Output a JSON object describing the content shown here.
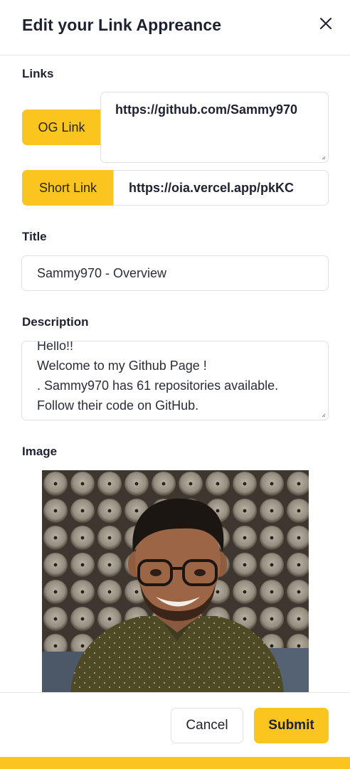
{
  "modal": {
    "title": "Edit your Link Appreance",
    "close_icon": "close-icon"
  },
  "links": {
    "label": "Links",
    "og": {
      "addon_label": "OG Link",
      "value": "https://github.com/Sammy970"
    },
    "short": {
      "addon_label": "Short Link",
      "value": "https://oia.vercel.app/pkKC"
    }
  },
  "title_section": {
    "label": "Title",
    "value": "Sammy970 - Overview"
  },
  "description_section": {
    "label": "Description",
    "value": "Hello!!\nWelcome to my Github Page !\n. Sammy970 has 61 repositories available.\nFollow their code on GitHub."
  },
  "image_section": {
    "label": "Image"
  },
  "footer": {
    "cancel_label": "Cancel",
    "submit_label": "Submit"
  },
  "colors": {
    "accent": "#fac51e",
    "text": "#1e2230",
    "border": "#dfe1e6"
  }
}
